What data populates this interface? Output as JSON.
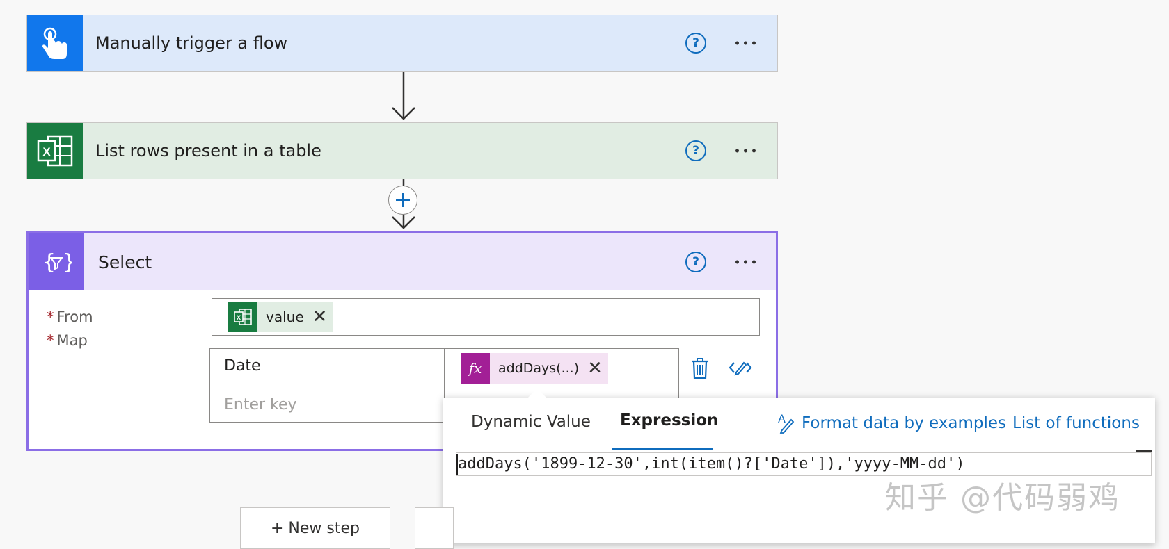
{
  "steps": {
    "trigger": {
      "title": "Manually trigger a flow",
      "icon": "touch-icon",
      "color": "#1177ec"
    },
    "list_rows": {
      "title": "List rows present in a table",
      "icon": "excel-icon",
      "color": "#197c41"
    },
    "select": {
      "title": "Select",
      "icon": "select-data-operation-icon",
      "color": "#7b5fe6"
    }
  },
  "help_glyph": "?",
  "select_form": {
    "from_label": "From",
    "map_label": "Map",
    "required_mark": "*",
    "from_token": {
      "label": "value",
      "icon": "excel-icon"
    },
    "map_rows": [
      {
        "key": "Date",
        "value_token": {
          "label": "addDays(...)",
          "icon": "fx-icon"
        }
      },
      {
        "key_placeholder": "Enter key"
      }
    ]
  },
  "expression_panel": {
    "tabs": [
      "Dynamic Value",
      "Expression"
    ],
    "active_tab": "Expression",
    "links": [
      "Format data by examples",
      "List of functions"
    ],
    "expression_value": "addDays('1899-12-30',int(item()?['Date']),'yyyy-MM-dd')"
  },
  "new_step_label": "+ New step",
  "watermark": "知乎 @代码弱鸡"
}
